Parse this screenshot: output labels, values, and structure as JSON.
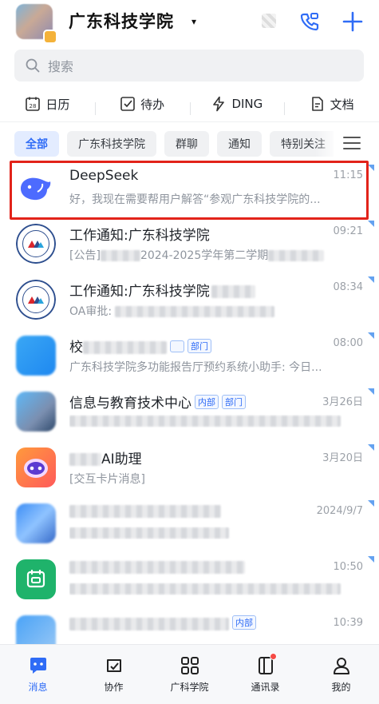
{
  "header": {
    "org_name": "广东科技学院",
    "caret": "▾"
  },
  "search": {
    "placeholder": "搜索"
  },
  "tools": [
    {
      "label": "日历",
      "icon": "calendar-icon"
    },
    {
      "label": "待办",
      "icon": "todo-check-icon"
    },
    {
      "label": "DING",
      "icon": "ding-lightning-icon"
    },
    {
      "label": "文档",
      "icon": "document-icon"
    }
  ],
  "filters": {
    "items": [
      "全部",
      "广东科技学院",
      "群聊",
      "通知",
      "特别关注"
    ],
    "active": "全部"
  },
  "chats": [
    {
      "title": "DeepSeek",
      "subtitle": "好，我现在需要帮用户解答“参观广东科技学院的...",
      "time": "11:15"
    },
    {
      "title": "工作通知:广东科技学院",
      "subtitle_prefix": "[公告]",
      "subtitle_mid": "2024-2025学年第二学期",
      "time": "09:21"
    },
    {
      "title": "工作通知:广东科技学院",
      "subtitle_prefix": "OA审批:",
      "time": "08:34"
    },
    {
      "title": "校",
      "tag": "部门",
      "subtitle": "广东科技学院多功能报告厅预约系统小助手: 今日...",
      "time": "08:00"
    },
    {
      "title": "信息与教育技术中心",
      "tags": [
        "内部",
        "部门"
      ],
      "time": "3月26日"
    },
    {
      "title": "AI助理",
      "subtitle": "[交互卡片消息]",
      "time": "3月20日"
    },
    {
      "title": "",
      "time": "2024/9/7"
    },
    {
      "title": "",
      "time": "10:50"
    },
    {
      "title": "",
      "tag": "内部",
      "time": "10:39"
    }
  ],
  "tabbar": [
    {
      "label": "消息",
      "icon": "message-icon",
      "active": true
    },
    {
      "label": "协作",
      "icon": "collaboration-icon",
      "active": false
    },
    {
      "label": "广科学院",
      "icon": "apps-grid-icon",
      "active": false
    },
    {
      "label": "通讯录",
      "icon": "contacts-icon",
      "active": false
    },
    {
      "label": "我的",
      "icon": "profile-icon",
      "active": false
    }
  ],
  "colors": {
    "accent": "#2f6cf6",
    "highlight": "#e2231a",
    "badge": "#f54a45"
  }
}
